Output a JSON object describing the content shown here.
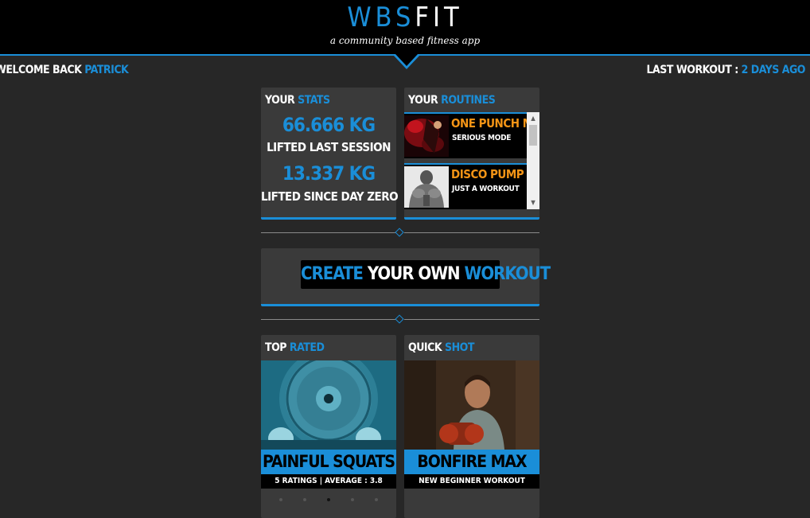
{
  "brand": {
    "name_blue": "WBS",
    "name_white": "FIT",
    "tagline": "a community based fitness app"
  },
  "user": {
    "welcome_prefix": "WELCOME BACK ",
    "name": "PATRICK"
  },
  "last_workout": {
    "label": "LAST WORKOUT : ",
    "value": "2 DAYS AGO"
  },
  "stats": {
    "title_white": "YOUR ",
    "title_blue": "STATS",
    "last_session_value": "66.666 KG",
    "last_session_label": "LIFTED LAST SESSION",
    "since_day_zero_value": "13.337 KG",
    "since_day_zero_label": "LIFTED SINCE DAY ZERO"
  },
  "routines": {
    "title_white": "YOUR ",
    "title_blue": "ROUTINES",
    "items": [
      {
        "name": "ONE PUNCH MAN",
        "subtitle": "SERIOUS MODE"
      },
      {
        "name": "DISCO PUMP",
        "subtitle": "JUST A WORKOUT"
      }
    ]
  },
  "create": {
    "part1": "CREATE",
    "part2": " YOUR OWN ",
    "part3": "WORKOUT"
  },
  "top_rated": {
    "title_white": "TOP ",
    "title_blue": "RATED",
    "name": "PAINFUL SQUATS",
    "subtitle": "5 RATINGS | AVERAGE : 3.8"
  },
  "quick_shot": {
    "title_white": "QUICK ",
    "title_blue": "SHOT",
    "name": "BONFIRE MAX",
    "subtitle": "NEW BEGINNER WORKOUT"
  },
  "carousel": {
    "active_index": 2,
    "count": 5
  }
}
